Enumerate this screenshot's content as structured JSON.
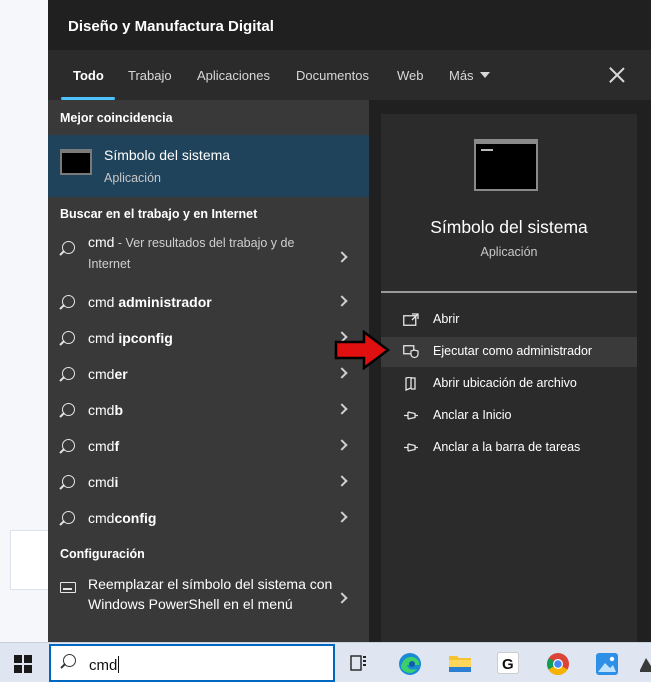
{
  "panel": {
    "title": "Diseño y Manufactura Digital"
  },
  "tabs": [
    "Todo",
    "Trabajo",
    "Aplicaciones",
    "Documentos",
    "Web",
    "Más"
  ],
  "best_match": {
    "section": "Mejor coincidencia",
    "title": "Símbolo del sistema",
    "subtitle": "Aplicación"
  },
  "web_section": "Buscar en el trabajo y en Internet",
  "web_first": {
    "term": "cmd",
    "desc": " - Ver resultados del trabajo y de Internet"
  },
  "suggestions": [
    {
      "plain": "cmd ",
      "bold": "administrador"
    },
    {
      "plain": "cmd ",
      "bold": "ipconfig"
    },
    {
      "plain": "cmd",
      "bold": "er"
    },
    {
      "plain": "cmd",
      "bold": "b"
    },
    {
      "plain": "cmd",
      "bold": "f"
    },
    {
      "plain": "cmd",
      "bold": "i"
    },
    {
      "plain": "cmd",
      "bold": "config"
    }
  ],
  "config": {
    "section": "Configuración",
    "item": "Reemplazar el símbolo del sistema con Windows PowerShell en el menú"
  },
  "detail": {
    "title": "Símbolo del sistema",
    "subtitle": "Aplicación",
    "actions": [
      {
        "label": "Abrir",
        "icon": "open-icon"
      },
      {
        "label": "Ejecutar como administrador",
        "icon": "shield-icon"
      },
      {
        "label": "Abrir ubicación de archivo",
        "icon": "file-location-icon"
      },
      {
        "label": "Anclar a Inicio",
        "icon": "pin-icon"
      },
      {
        "label": "Anclar a la barra de tareas",
        "icon": "pin-icon"
      }
    ]
  },
  "taskbar": {
    "search_value": "cmd",
    "apps": [
      "task-view-icon",
      "edge-icon",
      "file-explorer-icon",
      "g-app-icon",
      "chrome-icon",
      "photos-icon"
    ]
  },
  "colors": {
    "accent": "#4cc2ff",
    "highlight": "#20435c",
    "arrow": "#e01010"
  }
}
